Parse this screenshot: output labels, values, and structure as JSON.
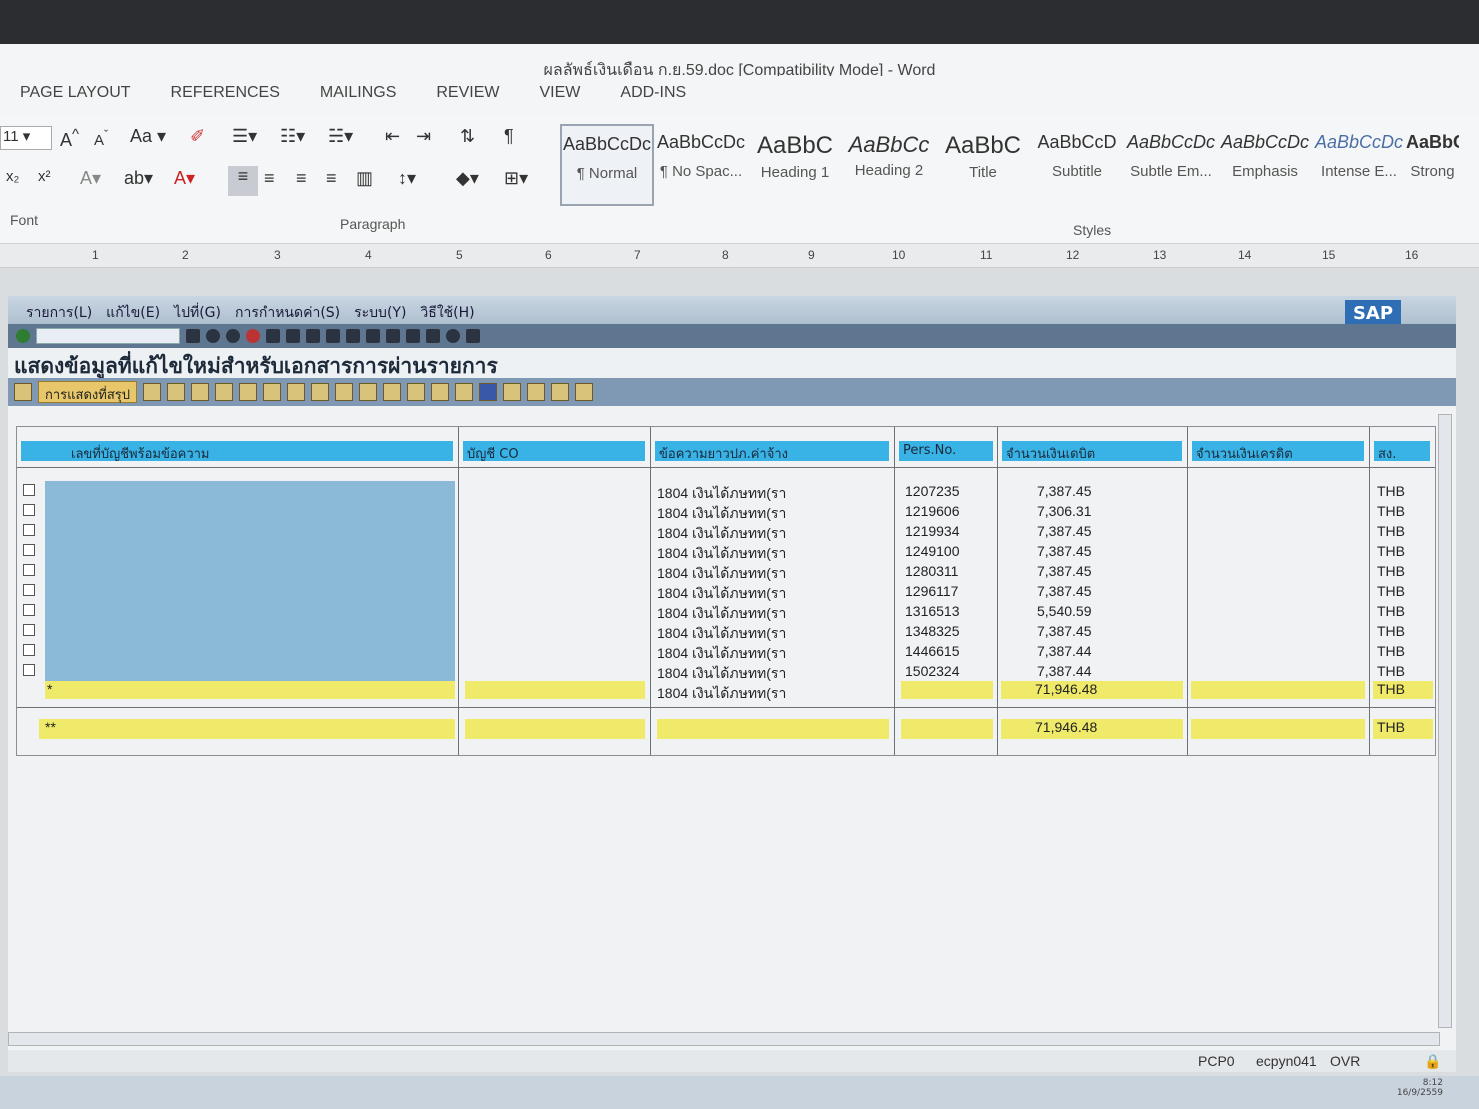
{
  "word": {
    "title": "ผลลัพธ์เงินเดือน ก.ย.59.doc [Compatibility Mode] - Word",
    "tabs": [
      "PAGE LAYOUT",
      "REFERENCES",
      "MAILINGS",
      "REVIEW",
      "VIEW",
      "ADD-INS"
    ],
    "font_size": "11",
    "group_labels": {
      "font": "Font",
      "paragraph": "Paragraph",
      "styles": "Styles"
    },
    "styles": [
      {
        "sample": "AaBbCcDc",
        "name": "¶ Normal"
      },
      {
        "sample": "AaBbCcDc",
        "name": "¶ No Spac..."
      },
      {
        "sample": "AaBbC",
        "name": "Heading 1"
      },
      {
        "sample": "AaBbCc",
        "name": "Heading 2"
      },
      {
        "sample": "AaBbC",
        "name": "Title"
      },
      {
        "sample": "AaBbCcD",
        "name": "Subtitle"
      },
      {
        "sample": "AaBbCcDc",
        "name": "Subtle Em..."
      },
      {
        "sample": "AaBbCcDc",
        "name": "Emphasis"
      },
      {
        "sample": "AaBbCcDc",
        "name": "Intense E..."
      },
      {
        "sample": "AaBbCc",
        "name": "Strong"
      }
    ],
    "ruler": [
      "1",
      "2",
      "3",
      "4",
      "5",
      "6",
      "7",
      "8",
      "9",
      "10",
      "11",
      "12",
      "13",
      "14",
      "15",
      "16"
    ]
  },
  "sap": {
    "menu": [
      "รายการ(L)",
      "แก้ไข(E)",
      "ไปที่(G)",
      "การกำหนดค่า(S)",
      "ระบบ(Y)",
      "วิธีใช้(H)"
    ],
    "logo": "SAP",
    "title": "แสดงข้อมูลที่แก้ไขใหม่สำหรับเอกสารการผ่านรายการ",
    "summary_button": "การแสดงที่สรุป",
    "columns": [
      "เลขที่บัญชีพร้อมข้อความ",
      "บัญชี CO",
      "ข้อความยาวปภ.ค่าจ้าง",
      "Pers.No.",
      "จำนวนเงินเดบิต",
      "จำนวนเงินเครดิต",
      "สง."
    ],
    "rows": [
      {
        "text": "1804 เงินได้ภษทท(รา",
        "pers": "1207235",
        "debit": "7,387.45",
        "cur": "THB"
      },
      {
        "text": "1804 เงินได้ภษทท(รา",
        "pers": "1219606",
        "debit": "7,306.31",
        "cur": "THB"
      },
      {
        "text": "1804 เงินได้ภษทท(รา",
        "pers": "1219934",
        "debit": "7,387.45",
        "cur": "THB"
      },
      {
        "text": "1804 เงินได้ภษทท(รา",
        "pers": "1249100",
        "debit": "7,387.45",
        "cur": "THB"
      },
      {
        "text": "1804 เงินได้ภษทท(รา",
        "pers": "1280311",
        "debit": "7,387.45",
        "cur": "THB"
      },
      {
        "text": "1804 เงินได้ภษทท(รา",
        "pers": "1296117",
        "debit": "7,387.45",
        "cur": "THB"
      },
      {
        "text": "1804 เงินได้ภษทท(รา",
        "pers": "1316513",
        "debit": "5,540.59",
        "cur": "THB"
      },
      {
        "text": "1804 เงินได้ภษทท(รา",
        "pers": "1348325",
        "debit": "7,387.45",
        "cur": "THB"
      },
      {
        "text": "1804 เงินได้ภษทท(รา",
        "pers": "1446615",
        "debit": "7,387.44",
        "cur": "THB"
      },
      {
        "text": "1804 เงินได้ภษทท(รา",
        "pers": "1502324",
        "debit": "7,387.44",
        "cur": "THB"
      }
    ],
    "subtotal": {
      "marker": "*",
      "text": "1804 เงินได้ภษทท(รา",
      "debit": "71,946.48",
      "cur": "THB"
    },
    "total": {
      "marker": "**",
      "debit": "71,946.48",
      "cur": "THB"
    },
    "status": {
      "system": "PCP0",
      "server": "ecpyn041",
      "mode": "OVR"
    }
  },
  "taskbar": {
    "time": "8:12",
    "date": "16/9/2559"
  }
}
